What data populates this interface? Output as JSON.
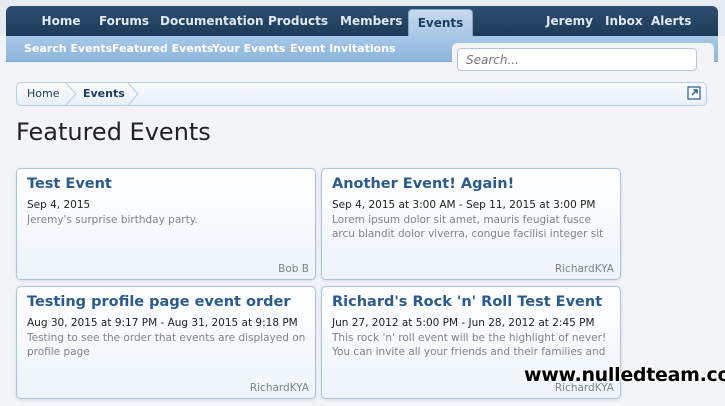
{
  "nav": {
    "tabs": [
      "Home",
      "Forums",
      "Documentation",
      "Products",
      "Members",
      "Events"
    ],
    "active": "Events",
    "user": "Jeremy",
    "inbox": "Inbox",
    "alerts": "Alerts"
  },
  "subnav": {
    "items": [
      "Search Events",
      "Featured Events",
      "Your Events",
      "Event Invitations"
    ]
  },
  "search": {
    "placeholder": "Search..."
  },
  "breadcrumb": {
    "items": [
      "Home",
      "Events"
    ]
  },
  "page": {
    "title": "Featured Events"
  },
  "events": [
    {
      "title": "Test Event",
      "date": "Sep 4, 2015",
      "description": "Jeremy's surprise birthday party.",
      "author": "Bob B"
    },
    {
      "title": "Another Event! Again!",
      "date": "Sep 4, 2015 at 3:00 AM - Sep 11, 2015 at 3:00 PM",
      "description": "Lorem ipsum dolor sit amet, mauris feugiat fusce arcu blandit dolor viverra, congue facilisi integer sit magna",
      "author": "RichardKYA"
    },
    {
      "title": "Testing profile page event order",
      "date": "Aug 30, 2015 at 9:17 PM - Aug 31, 2015 at 9:18 PM",
      "description": "Testing to see the order that events are displayed on profile page",
      "author": "RichardKYA"
    },
    {
      "title": "Richard's Rock 'n' Roll Test Event",
      "date": "Jun 27, 2012 at 5:00 PM - Jun 28, 2012 at 2:45 PM",
      "description": "This rock 'n' roll event will be the highlight of never! You can invite all your friends and their families and you will",
      "author": "RichardKYA"
    }
  ],
  "watermark": "www.nulledteam.com"
}
